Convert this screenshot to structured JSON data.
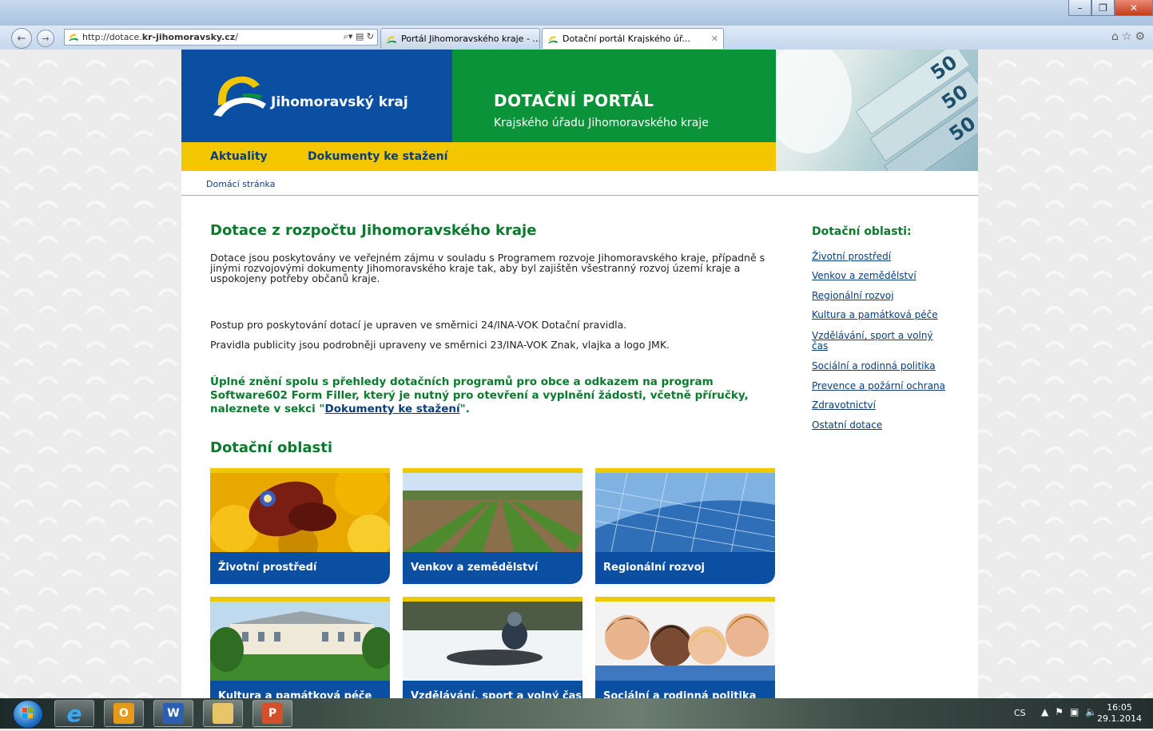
{
  "browser": {
    "url_prefix": "http://dotace.",
    "url_domain": "kr-jihomoravsky.cz",
    "url_suffix": "/",
    "tabs": [
      {
        "label": "Portál Jihomoravského kraje - ..."
      },
      {
        "label": "Dotační portál Krajského úř..."
      }
    ]
  },
  "header": {
    "logo_text": "Jihomoravský kraj",
    "portal_title": "DOTAČNÍ PORTÁL",
    "portal_subtitle": "Krajského úřadu Jihomoravského kraje"
  },
  "nav": {
    "items": [
      {
        "label": "Aktuality"
      },
      {
        "label": "Dokumenty ke stažení"
      }
    ]
  },
  "breadcrumb": "Domácí stránka",
  "main": {
    "title": "Dotace z rozpočtu Jihomoravského kraje",
    "intro": "Dotace jsou poskytovány ve veřejném zájmu v souladu s Programem rozvoje Jihomoravského kraje, případně s jinými rozvojovými dokumenty Jihomoravského kraje tak, aby byl zajištěn všestranný rozvoj území kraje a uspokojeny potřeby občanů kraje.",
    "rule1": "Postup pro poskytování dotací je upraven ve směrnici 24/INA-VOK Dotační pravidla.",
    "rule2": "Pravidla publicity jsou podrobněji upraveny ve směrnici 23/INA-VOK Znak, vlajka a logo JMK.",
    "notice_before": "Úplné znění spolu s přehledy dotačních programů pro obce a odkazem na program Software602 Form Filler, který je nutný pro otevření a vyplnění žádosti, včetně příručky, naleznete v sekci \"",
    "notice_link": "Dokumenty ke stažení",
    "notice_after": "\".",
    "areas_heading": "Dotační oblasti",
    "tiles": [
      {
        "label": "Životní prostředí"
      },
      {
        "label": "Venkov a zemědělství"
      },
      {
        "label": "Regionální rozvoj"
      },
      {
        "label": "Kultura a památková péče"
      },
      {
        "label": "Vzdělávání, sport a volný čas"
      },
      {
        "label": "Sociální a rodinná politika"
      }
    ]
  },
  "sidebar": {
    "title": "Dotační oblasti:",
    "links": [
      {
        "label": "Životní prostředí"
      },
      {
        "label": "Venkov a zemědělství"
      },
      {
        "label": "Regionální rozvoj"
      },
      {
        "label": "Kultura a památková péče"
      },
      {
        "label": "Vzdělávání, sport a volný čas"
      },
      {
        "label": "Sociální a rodinná politika"
      },
      {
        "label": "Prevence a požární ochrana"
      },
      {
        "label": "Zdravotnictví"
      },
      {
        "label": "Ostatní dotace"
      }
    ]
  },
  "taskbar": {
    "lang": "CS",
    "time": "16:05",
    "date": "29.1.2014"
  },
  "colors": {
    "brand_blue": "#0a4fa2",
    "brand_green": "#0b9339",
    "brand_yellow": "#f2c600",
    "heading_green": "#0a7a2f",
    "link_blue": "#0a3d7a"
  }
}
